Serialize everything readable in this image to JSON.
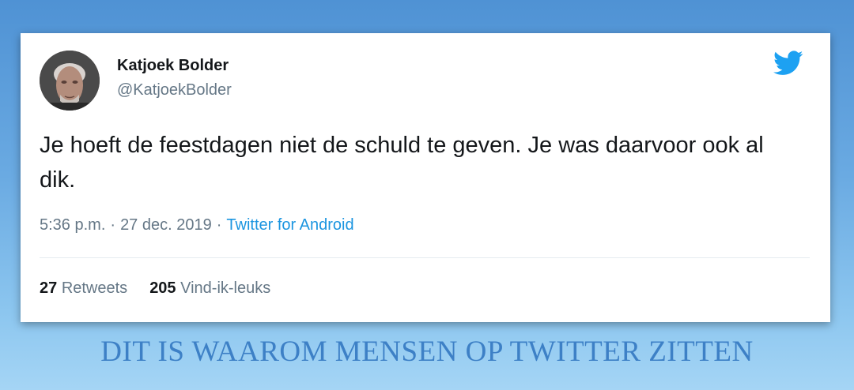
{
  "tweet": {
    "author_name": "Katjoek Bolder",
    "author_handle": "@KatjoekBolder",
    "text": "Je hoeft de feestdagen niet de schuld te geven. Je was daarvoor ook al dik.",
    "time": "5:36 p.m.",
    "date": "27 dec. 2019",
    "separator": "·",
    "source": "Twitter for Android",
    "retweets_count": "27",
    "retweets_label": "Retweets",
    "likes_count": "205",
    "likes_label": "Vind-ik-leuks",
    "logo_icon": "twitter-bird-icon"
  },
  "caption": "DIT IS WAAROM MENSEN OP TWITTER ZITTEN",
  "colors": {
    "link": "#1b95e0",
    "secondary_text": "#657786",
    "primary_text": "#14171a",
    "caption": "#3d80c6"
  }
}
